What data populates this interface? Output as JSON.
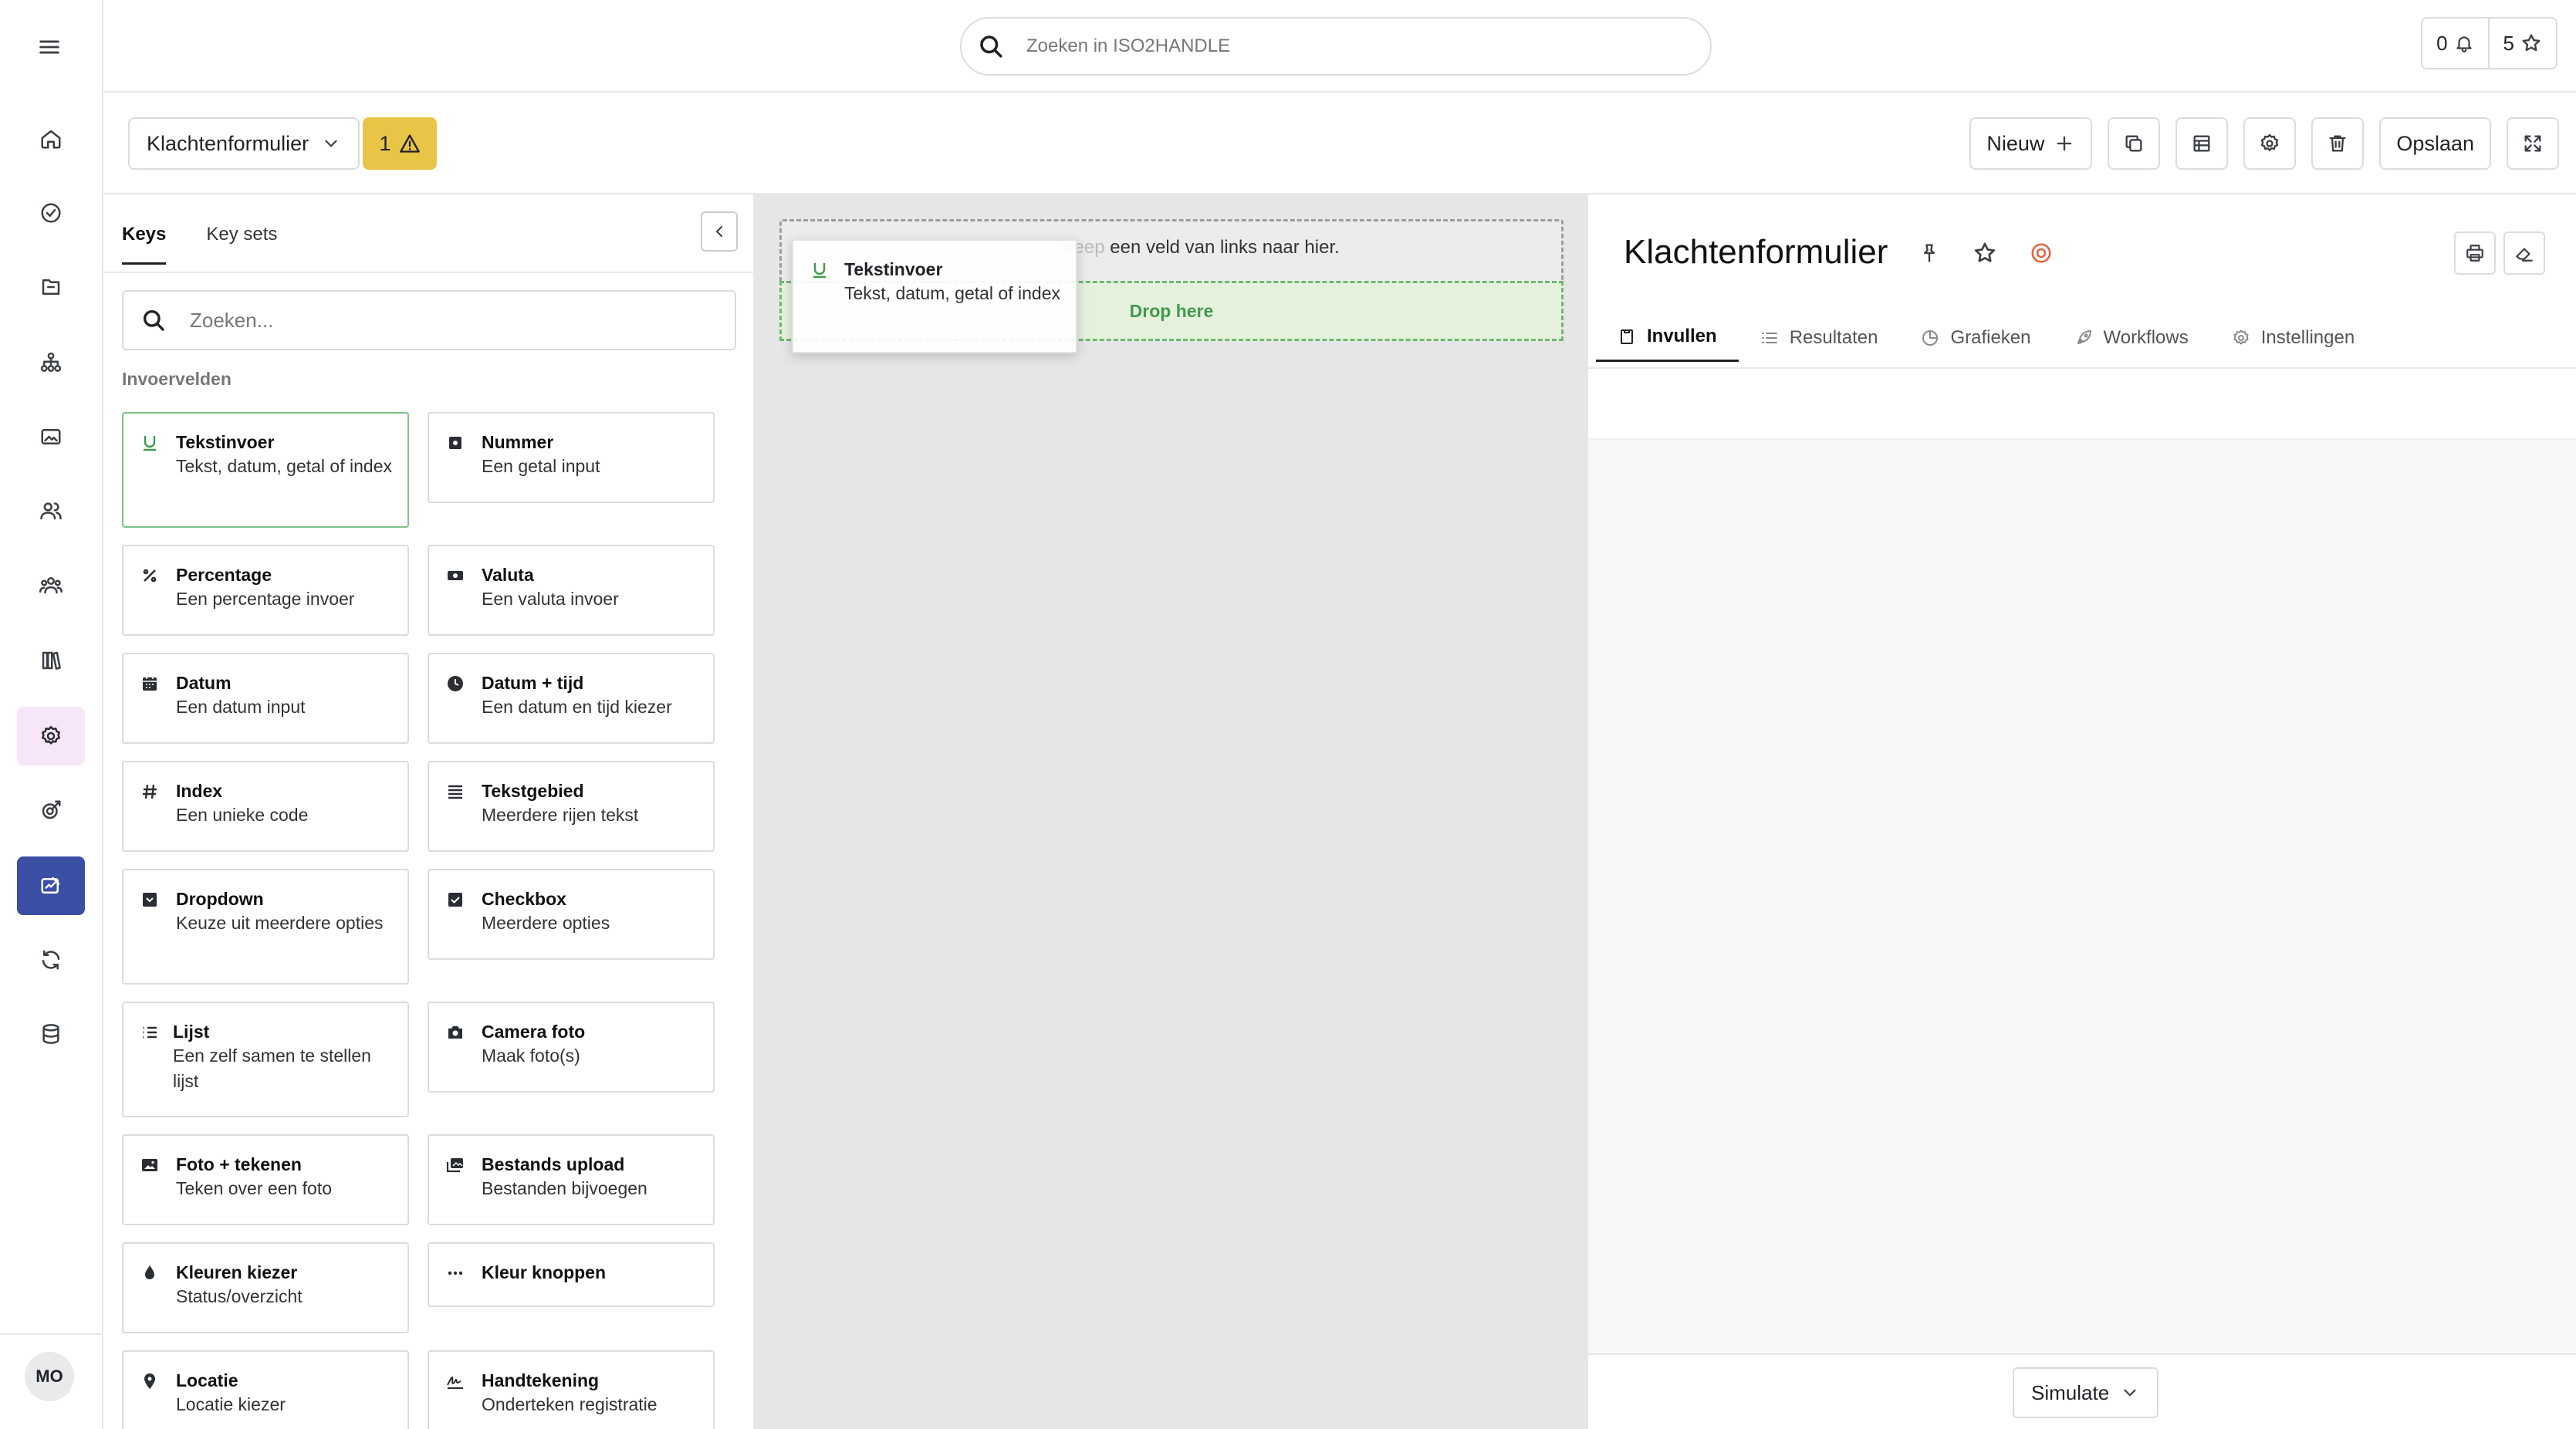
{
  "search": {
    "placeholder": "Zoeken in ISO2HANDLE"
  },
  "counters": {
    "notifications": "0",
    "favorites": "5"
  },
  "user": {
    "initials": "MO"
  },
  "toolbar": {
    "form_name": "Klachtenformulier",
    "warning_count": "1",
    "new_label": "Nieuw",
    "save_label": "Opslaan"
  },
  "keys_panel": {
    "tabs": [
      "Keys",
      "Key sets"
    ],
    "search_placeholder": "Zoeken...",
    "section_label": "Invoervelden",
    "fields": [
      {
        "title": "Tekstinvoer",
        "desc": "Tekst, datum, getal of index",
        "icon": "text-input-icon"
      },
      {
        "title": "Nummer",
        "desc": "Een getal input",
        "icon": "number-icon"
      },
      {
        "title": "Percentage",
        "desc": "Een percentage invoer",
        "icon": "percent-icon"
      },
      {
        "title": "Valuta",
        "desc": "Een valuta invoer",
        "icon": "currency-icon"
      },
      {
        "title": "Datum",
        "desc": "Een datum input",
        "icon": "calendar-icon"
      },
      {
        "title": "Datum + tijd",
        "desc": "Een datum en tijd kiezer",
        "icon": "clock-icon"
      },
      {
        "title": "Index",
        "desc": "Een unieke code",
        "icon": "hash-icon"
      },
      {
        "title": "Tekstgebied",
        "desc": "Meerdere rijen tekst",
        "icon": "textarea-icon"
      },
      {
        "title": "Dropdown",
        "desc": "Keuze uit meerdere opties",
        "icon": "dropdown-icon"
      },
      {
        "title": "Checkbox",
        "desc": "Meerdere opties",
        "icon": "checkbox-icon"
      },
      {
        "title": "Lijst",
        "desc": "Een zelf samen te stellen lijst",
        "icon": "list-icon"
      },
      {
        "title": "Camera foto",
        "desc": "Maak foto(s)",
        "icon": "camera-icon"
      },
      {
        "title": "Foto + tekenen",
        "desc": "Teken over een foto",
        "icon": "image-icon"
      },
      {
        "title": "Bestands upload",
        "desc": "Bestanden bijvoegen",
        "icon": "images-icon"
      },
      {
        "title": "Kleuren kiezer",
        "desc": "Status/overzicht",
        "icon": "droplet-icon"
      },
      {
        "title": "Kleur knoppen",
        "desc": "",
        "icon": "dots-icon"
      },
      {
        "title": "Locatie",
        "desc": "Locatie kiezer",
        "icon": "pin-icon"
      },
      {
        "title": "Handtekening",
        "desc": "Onderteken registratie",
        "icon": "signature-icon"
      }
    ]
  },
  "canvas": {
    "hint_text": "een veld van links naar hier.",
    "hint_faded": "Sleep",
    "drop_label": "Drop here",
    "drag_ghost": {
      "title": "Tekstinvoer",
      "desc": "Tekst, datum, getal of index"
    }
  },
  "preview": {
    "title": "Klachtenformulier",
    "tabs": [
      "Invullen",
      "Resultaten",
      "Grafieken",
      "Workflows",
      "Instellingen"
    ],
    "simulate_label": "Simulate"
  },
  "colors": {
    "accent_blue": "#3b4fa5",
    "accent_pink": "#f7e6f8",
    "warning_yellow": "#e8c547",
    "drop_green": "#3f9a4c",
    "target_orange": "#e8603c"
  }
}
